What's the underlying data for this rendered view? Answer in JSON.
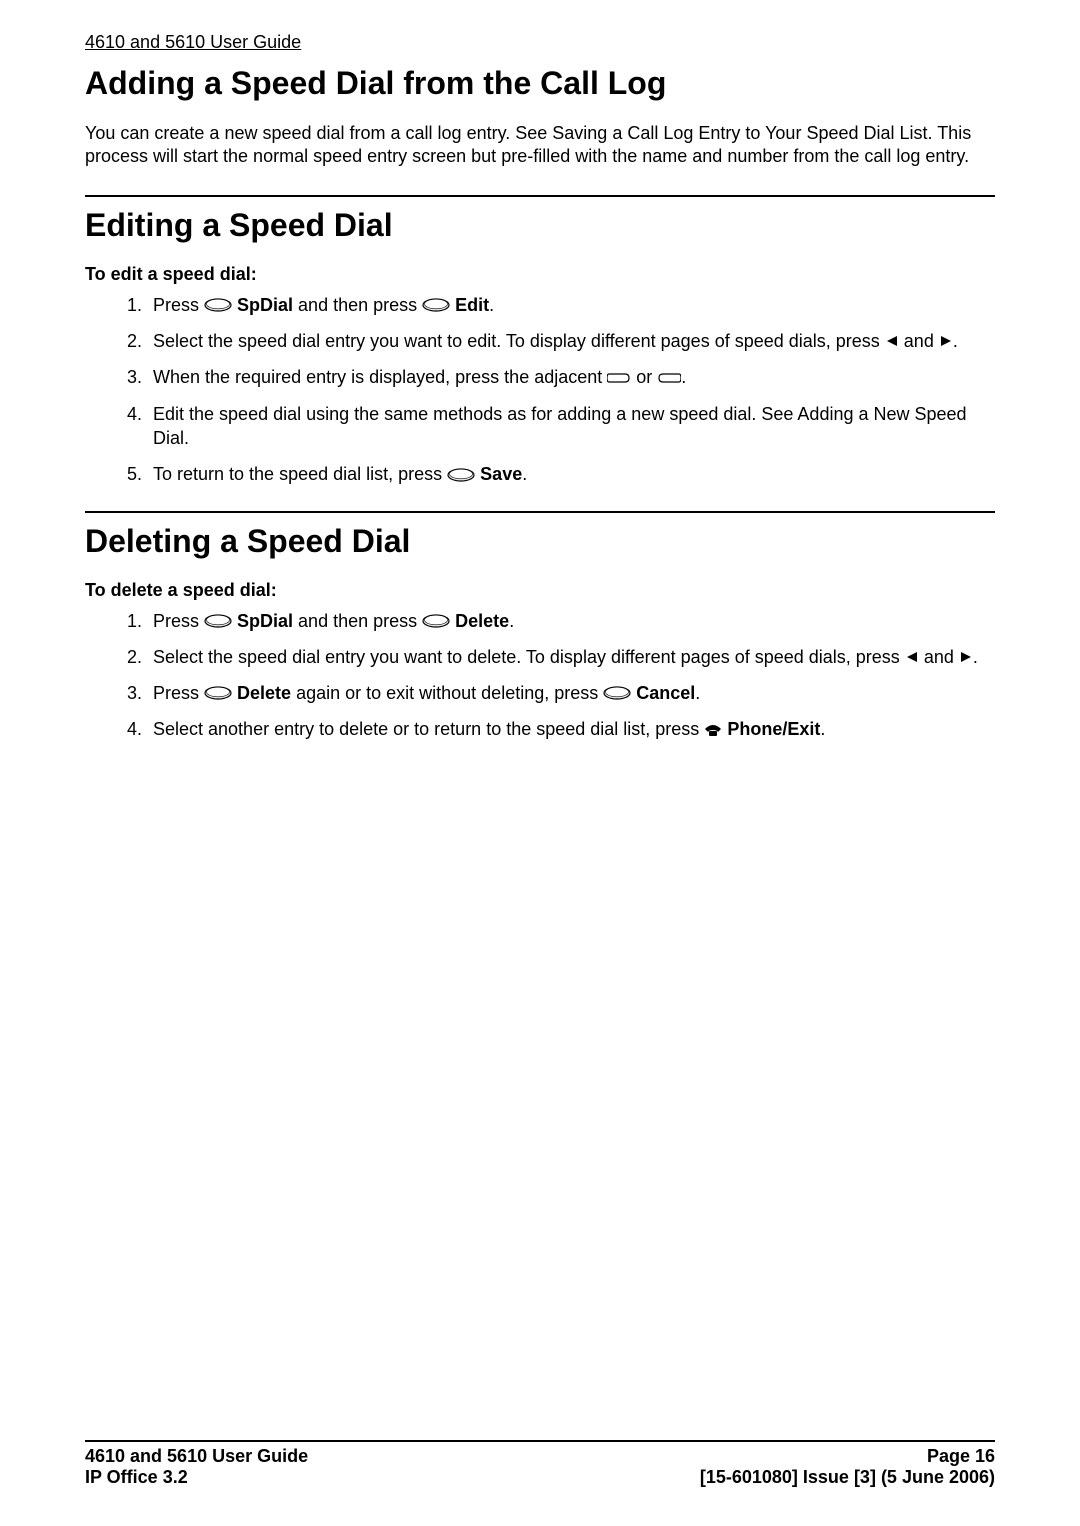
{
  "header": "4610 and 5610 User Guide",
  "section1": {
    "title": "Adding a Speed Dial from the Call Log",
    "body": "You can create a new speed dial from a call log entry. See Saving a Call Log Entry to Your Speed Dial List. This process will start the normal speed entry screen but pre-filled with the name and number from the call log entry."
  },
  "section2": {
    "title": "Editing a Speed Dial",
    "subheading": "To edit a speed dial:",
    "steps": {
      "s1a": "Press ",
      "s1b": "SpDial",
      "s1c": " and then press ",
      "s1d": "Edit",
      "s1e": ".",
      "s2a": "Select the speed dial entry you want to edit. To display different pages of speed dials, press ",
      "s2b": " and ",
      "s2c": ".",
      "s3a": "When the required entry is displayed, press the adjacent ",
      "s3b": " or ",
      "s3c": ".",
      "s4": "Edit the speed dial using the same methods as for adding a new speed dial. See Adding a New Speed Dial.",
      "s5a": "To return to the speed dial list, press ",
      "s5b": "Save",
      "s5c": "."
    }
  },
  "section3": {
    "title": "Deleting a Speed Dial",
    "subheading": "To delete a speed dial:",
    "steps": {
      "s1a": "Press ",
      "s1b": "SpDial",
      "s1c": " and then press ",
      "s1d": "Delete",
      "s1e": ".",
      "s2a": "Select the speed dial entry you want to delete. To display different pages of speed dials, press ",
      "s2b": " and ",
      "s2c": ".",
      "s3a": "Press ",
      "s3b": "Delete",
      "s3c": " again or to exit without deleting, press ",
      "s3d": "Cancel",
      "s3e": ".",
      "s4a": "Select another entry to delete or to return to the speed dial list, press ",
      "s4b": "Phone/Exit",
      "s4c": "."
    }
  },
  "footer": {
    "left1": "4610 and 5610 User Guide",
    "left2": "IP Office 3.2",
    "right1": "Page 16",
    "right2": "[15-601080] Issue [3] (5 June 2006)"
  }
}
